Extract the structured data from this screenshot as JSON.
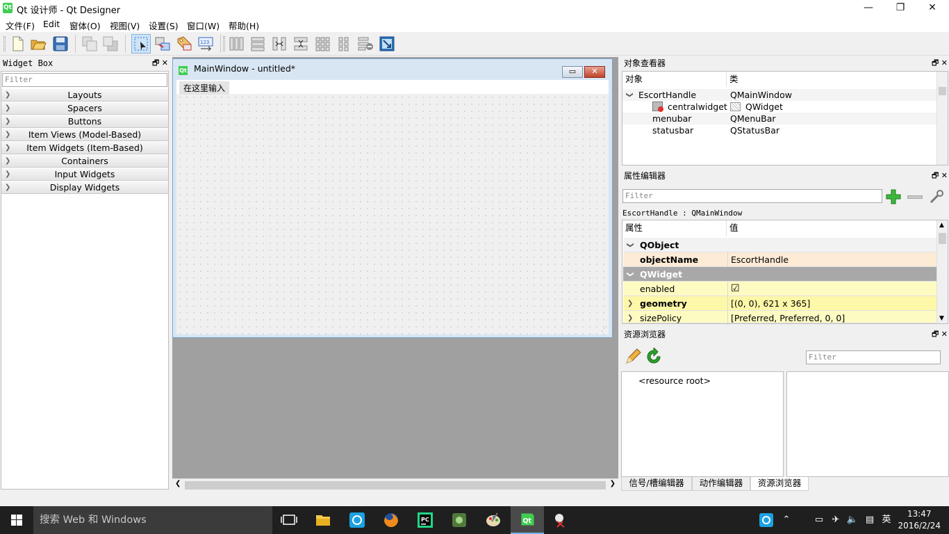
{
  "window": {
    "title": "Qt 设计师 - Qt Designer",
    "logo_text": "Qt",
    "minimize_glyph": "—",
    "restore_glyph": "❐",
    "close_glyph": "✕"
  },
  "menubar": [
    "文件(F)",
    "Edit",
    "窗体(O)",
    "视图(V)",
    "设置(S)",
    "窗口(W)",
    "帮助(H)"
  ],
  "widget_box": {
    "title": "Widget Box",
    "filter_placeholder": "Filter",
    "categories": [
      "Layouts",
      "Spacers",
      "Buttons",
      "Item Views (Model-Based)",
      "Item Widgets (Item-Based)",
      "Containers",
      "Input Widgets",
      "Display Widgets"
    ]
  },
  "form_window": {
    "title": "MainWindow - untitled*",
    "menu_placeholder": "在这里输入"
  },
  "object_inspector": {
    "title": "对象查看器",
    "col_object": "对象",
    "col_class": "类",
    "rows": [
      {
        "object": "EscortHandle",
        "class": "QMainWindow"
      },
      {
        "object": "centralwidget",
        "class": "QWidget"
      },
      {
        "object": "menubar",
        "class": "QMenuBar"
      },
      {
        "object": "statusbar",
        "class": "QStatusBar"
      }
    ]
  },
  "property_editor": {
    "title": "属性编辑器",
    "filter_placeholder": "Filter",
    "context": "EscortHandle : QMainWindow",
    "col_property": "属性",
    "col_value": "值",
    "rows": [
      {
        "key": "QObject",
        "value": ""
      },
      {
        "key": "objectName",
        "value": "EscortHandle"
      },
      {
        "key": "QWidget",
        "value": ""
      },
      {
        "key": "enabled",
        "value": "☑"
      },
      {
        "key": "geometry",
        "value": "[(0, 0), 621 x 365]"
      },
      {
        "key": "sizePolicy",
        "value": "[Preferred, Preferred, 0, 0]"
      }
    ]
  },
  "resource_browser": {
    "title": "资源浏览器",
    "filter_placeholder": "Filter",
    "root_label": "<resource root>"
  },
  "bottom_tabs": [
    "信号/槽编辑器",
    "动作编辑器",
    "资源浏览器"
  ],
  "taskbar": {
    "search_placeholder": "搜索 Web 和 Windows",
    "ime": "英",
    "time": "13:47",
    "date": "2016/2/24"
  },
  "colors": {
    "objectname_row": "#fdebd6",
    "qwidget_group": "#a8a8a8",
    "yellow_row": "#fdfbc2",
    "taskbar": "#1f1f1f"
  }
}
